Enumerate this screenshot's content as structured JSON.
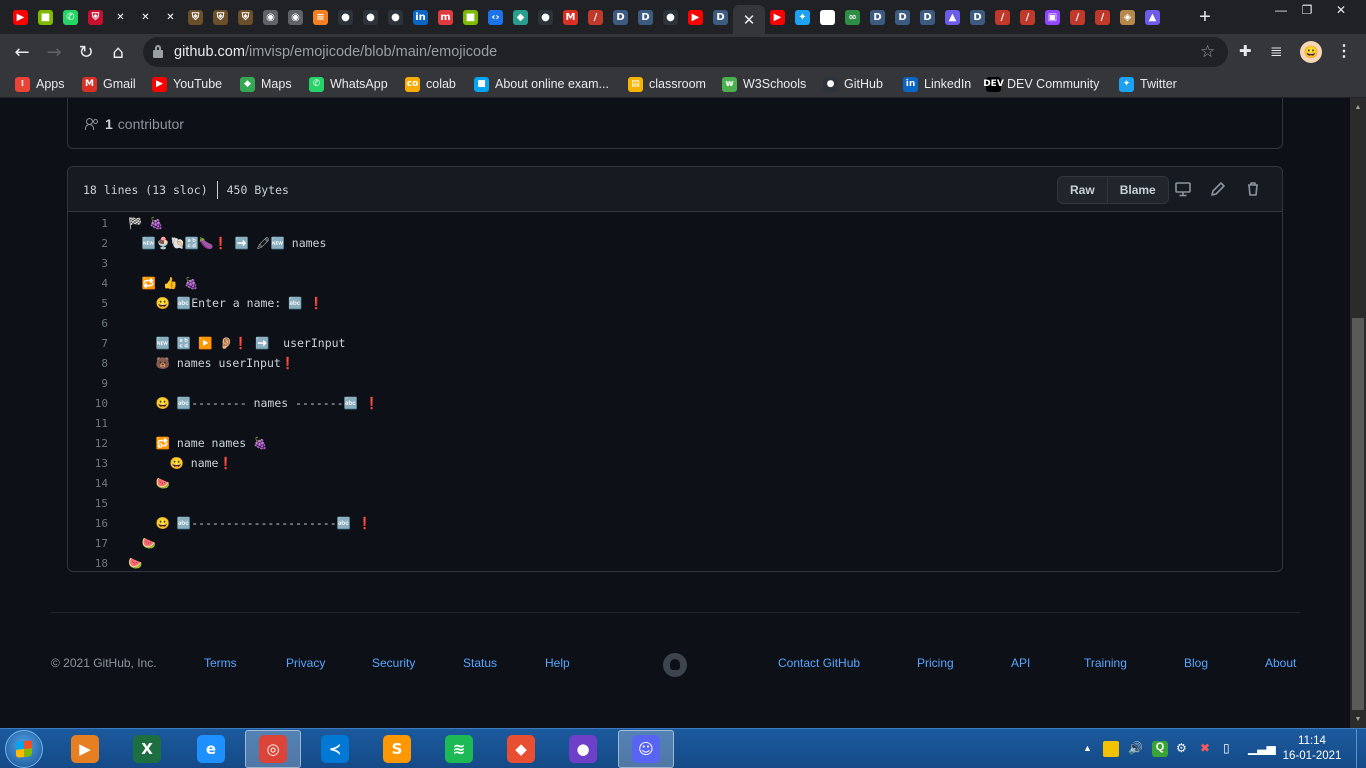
{
  "browser": {
    "tabs": [
      {
        "icon": "youtube-icon",
        "color": "#ff0000",
        "glyph": "▶"
      },
      {
        "icon": "microsoft-icon",
        "color": "#7fba00",
        "glyph": "■"
      },
      {
        "icon": "whatsapp-icon",
        "color": "#25d366",
        "glyph": "✆"
      },
      {
        "icon": "shield-icon",
        "color": "#c8102e",
        "glyph": "⛨"
      },
      {
        "icon": "x-icon",
        "color": "#202124",
        "glyph": "✕"
      },
      {
        "icon": "x-icon",
        "color": "#202124",
        "glyph": "✕"
      },
      {
        "icon": "x-icon",
        "color": "#202124",
        "glyph": "✕"
      },
      {
        "icon": "crest-icon",
        "color": "#6b4f2a",
        "glyph": "⛨"
      },
      {
        "icon": "crest-icon",
        "color": "#6b4f2a",
        "glyph": "⛨"
      },
      {
        "icon": "crest-icon",
        "color": "#6b4f2a",
        "glyph": "⛨"
      },
      {
        "icon": "globe-icon",
        "color": "#5f6368",
        "glyph": "◉"
      },
      {
        "icon": "globe-icon",
        "color": "#5f6368",
        "glyph": "◉"
      },
      {
        "icon": "stackoverflow-icon",
        "color": "#f48024",
        "glyph": "≡"
      },
      {
        "icon": "github-icon",
        "color": "#2d333b",
        "glyph": "●"
      },
      {
        "icon": "github-icon",
        "color": "#2d333b",
        "glyph": "●"
      },
      {
        "icon": "github-icon",
        "color": "#2d333b",
        "glyph": "●"
      },
      {
        "icon": "linkedin-icon",
        "color": "#0a66c2",
        "glyph": "in"
      },
      {
        "icon": "meetup-icon",
        "color": "#e0393e",
        "glyph": "m"
      },
      {
        "icon": "microsoft-icon",
        "color": "#7fba00",
        "glyph": "■"
      },
      {
        "icon": "code-icon",
        "color": "#1a73e8",
        "glyph": "‹›"
      },
      {
        "icon": "gitlab-icon",
        "color": "#2a9d8f",
        "glyph": "◆"
      },
      {
        "icon": "github-icon",
        "color": "#2d333b",
        "glyph": "●"
      },
      {
        "icon": "gmail-icon",
        "color": "#d93025",
        "glyph": "M"
      },
      {
        "icon": "ruler-icon",
        "color": "#c0392b",
        "glyph": "/"
      },
      {
        "icon": "dev-icon",
        "color": "#3d5a80",
        "glyph": "D"
      },
      {
        "icon": "dev-icon",
        "color": "#3d5a80",
        "glyph": "D"
      },
      {
        "icon": "github-icon",
        "color": "#2d333b",
        "glyph": "●"
      },
      {
        "icon": "youtube-icon",
        "color": "#ff0000",
        "glyph": "▶"
      },
      {
        "icon": "dev-icon",
        "color": "#3d5a80",
        "glyph": "D"
      },
      {
        "icon": "close-icon",
        "color": "#35363a",
        "glyph": "✕",
        "active": true
      },
      {
        "icon": "youtube-icon",
        "color": "#ff0000",
        "glyph": "▶"
      },
      {
        "icon": "twitter-icon",
        "color": "#1da1f2",
        "glyph": "✦"
      },
      {
        "icon": "google-icon",
        "color": "#ffffff",
        "glyph": "G"
      },
      {
        "icon": "geeks-icon",
        "color": "#2f8d46",
        "glyph": "∞"
      },
      {
        "icon": "dev-icon",
        "color": "#3d5a80",
        "glyph": "D"
      },
      {
        "icon": "dev-icon",
        "color": "#3d5a80",
        "glyph": "D"
      },
      {
        "icon": "dev-icon",
        "color": "#3d5a80",
        "glyph": "D"
      },
      {
        "icon": "drop-icon",
        "color": "#6c5ce7",
        "glyph": "▲"
      },
      {
        "icon": "dev-icon",
        "color": "#3d5a80",
        "glyph": "D"
      },
      {
        "icon": "ruler-icon",
        "color": "#c0392b",
        "glyph": "/"
      },
      {
        "icon": "ruler-icon",
        "color": "#c0392b",
        "glyph": "/"
      },
      {
        "icon": "twitch-icon",
        "color": "#9146ff",
        "glyph": "▣"
      },
      {
        "icon": "ruler-icon",
        "color": "#c0392b",
        "glyph": "/"
      },
      {
        "icon": "ruler-icon",
        "color": "#c0392b",
        "glyph": "/"
      },
      {
        "icon": "package-icon",
        "color": "#b5894b",
        "glyph": "◈"
      },
      {
        "icon": "drop-icon",
        "color": "#6c5ce7",
        "glyph": "▲"
      }
    ],
    "new_tab": "+",
    "window": {
      "minimize": "—",
      "restore": "❐",
      "close": "✕"
    },
    "nav": {
      "back": "←",
      "forward": "→",
      "reload": "↻",
      "home": "⌂"
    },
    "url_host": "github.com",
    "url_path": "/imvisp/emojicode/blob/main/emojicode",
    "star": "☆",
    "extensions": "✚",
    "media": "≣",
    "profile": "😀",
    "menu": "⋮"
  },
  "bookmarks": [
    {
      "label": "Apps",
      "icon": "apps-grid-icon",
      "color": "#ea4335",
      "glyph": "⁞"
    },
    {
      "label": "Gmail",
      "icon": "gmail-icon",
      "color": "#d93025",
      "glyph": "M"
    },
    {
      "label": "YouTube",
      "icon": "youtube-icon",
      "color": "#ff0000",
      "glyph": "▶"
    },
    {
      "label": "Maps",
      "icon": "maps-icon",
      "color": "#34a853",
      "glyph": "◆"
    },
    {
      "label": "WhatsApp",
      "icon": "whatsapp-icon",
      "color": "#25d366",
      "glyph": "✆"
    },
    {
      "label": "colab",
      "icon": "colab-icon",
      "color": "#f9ab00",
      "glyph": "co"
    },
    {
      "label": "About online exam...",
      "icon": "microsoft-icon",
      "color": "#00a4ef",
      "glyph": "■"
    },
    {
      "label": "classroom",
      "icon": "classroom-icon",
      "color": "#f4b400",
      "glyph": "▤"
    },
    {
      "label": "W3Schools",
      "icon": "w3schools-icon",
      "color": "#4caf50",
      "glyph": "w"
    },
    {
      "label": "GitHub",
      "icon": "github-icon",
      "color": "#2d333b",
      "glyph": "●"
    },
    {
      "label": "LinkedIn",
      "icon": "linkedin-icon",
      "color": "#0a66c2",
      "glyph": "in"
    },
    {
      "label": "DEV Community",
      "icon": "dev-icon",
      "color": "#000000",
      "glyph": "DEV"
    },
    {
      "label": "Twitter",
      "icon": "twitter-icon",
      "color": "#1da1f2",
      "glyph": "✦"
    }
  ],
  "repo": {
    "contributors_count": "1",
    "contributors_label": "contributor",
    "file_stats": "18 lines (13 sloc)",
    "file_size": "450 Bytes",
    "raw_label": "Raw",
    "blame_label": "Blame"
  },
  "code_lines": [
    {
      "n": "1",
      "text": "🏁 🍇"
    },
    {
      "n": "2",
      "text": "  🆕🍨🐚🔡🍆❗️ ➡️ 🖍🆕 names"
    },
    {
      "n": "3",
      "text": ""
    },
    {
      "n": "4",
      "text": "  🔁 👍 🍇"
    },
    {
      "n": "5",
      "text": "    😀 🔤Enter a name: 🔤 ❗️"
    },
    {
      "n": "6",
      "text": ""
    },
    {
      "n": "7",
      "text": "    🆕 🔡 ▶️ 👂🏼❗️ ➡️  userInput"
    },
    {
      "n": "8",
      "text": "    🐻 names userInput❗️"
    },
    {
      "n": "9",
      "text": ""
    },
    {
      "n": "10",
      "text": "    😀 🔤-------- names -------🔤 ❗️"
    },
    {
      "n": "11",
      "text": ""
    },
    {
      "n": "12",
      "text": "    🔂 name names 🍇"
    },
    {
      "n": "13",
      "text": "      😀 name❗️"
    },
    {
      "n": "14",
      "text": "    🍉"
    },
    {
      "n": "15",
      "text": ""
    },
    {
      "n": "16",
      "text": "    😀 🔤---------------------🔤 ❗️"
    },
    {
      "n": "17",
      "text": "  🍉"
    },
    {
      "n": "18",
      "text": "🍉"
    }
  ],
  "footer": {
    "copyright": "© 2021 GitHub, Inc.",
    "links_left": [
      "Terms",
      "Privacy",
      "Security",
      "Status",
      "Help"
    ],
    "links_right": [
      "Contact GitHub",
      "Pricing",
      "API",
      "Training",
      "Blog",
      "About"
    ]
  },
  "taskbar": {
    "apps": [
      {
        "name": "media-player",
        "icon": "media-player-icon",
        "color": "#e67e22",
        "glyph": "▶"
      },
      {
        "name": "excel",
        "icon": "excel-icon",
        "color": "#1d6f42",
        "glyph": "X"
      },
      {
        "name": "internet-explorer",
        "icon": "internet-explorer-icon",
        "color": "#1e90ff",
        "glyph": "e"
      },
      {
        "name": "chrome",
        "icon": "chrome-icon",
        "color": "#db4437",
        "glyph": "◎",
        "active": true
      },
      {
        "name": "vscode",
        "icon": "vscode-icon",
        "color": "#0078d4",
        "glyph": "≺"
      },
      {
        "name": "sublime",
        "icon": "sublime-icon",
        "color": "#ff9800",
        "glyph": "S"
      },
      {
        "name": "spotify",
        "icon": "spotify-icon",
        "color": "#1db954",
        "glyph": "≋"
      },
      {
        "name": "git-gui",
        "icon": "git-icon",
        "color": "#e84e31",
        "glyph": "◆"
      },
      {
        "name": "github-desktop",
        "icon": "github-desktop-icon",
        "color": "#6e40c9",
        "glyph": "●"
      },
      {
        "name": "discord",
        "icon": "discord-icon",
        "color": "#5865f2",
        "glyph": "☺",
        "active": true
      }
    ],
    "time": "11:14",
    "date": "16-01-2021"
  }
}
